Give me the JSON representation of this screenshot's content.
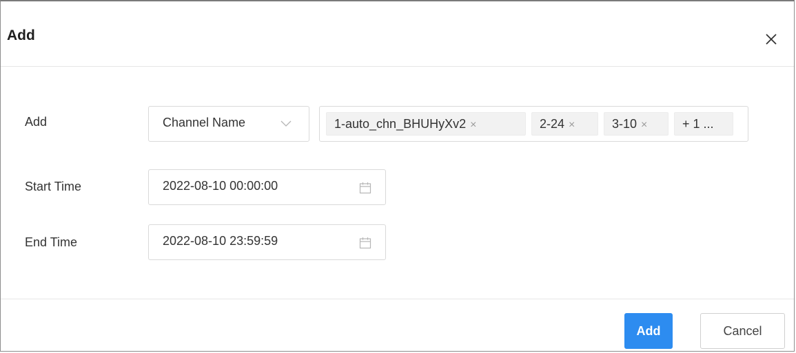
{
  "dialog": {
    "title": "Add"
  },
  "form": {
    "add": {
      "label": "Add",
      "type_select": {
        "value": "Channel Name"
      },
      "channels": [
        {
          "label": "1-auto_chn_BHUHyXv2"
        },
        {
          "label": "2-24"
        },
        {
          "label": "3-10"
        }
      ],
      "more_tag": "+ 1 ..."
    },
    "start_time": {
      "label": "Start Time",
      "value": "2022-08-10 00:00:00"
    },
    "end_time": {
      "label": "End Time",
      "value": "2022-08-10 23:59:59"
    }
  },
  "footer": {
    "add_label": "Add",
    "cancel_label": "Cancel"
  },
  "icons": {
    "close": "close-icon",
    "dropdown": "chevron-down-icon",
    "calendar": "calendar-icon",
    "tag_remove": "close-icon"
  },
  "colors": {
    "primary": "#2d8cf0",
    "tag_background": "#f2f2f2",
    "border": "#d9d9d9"
  }
}
